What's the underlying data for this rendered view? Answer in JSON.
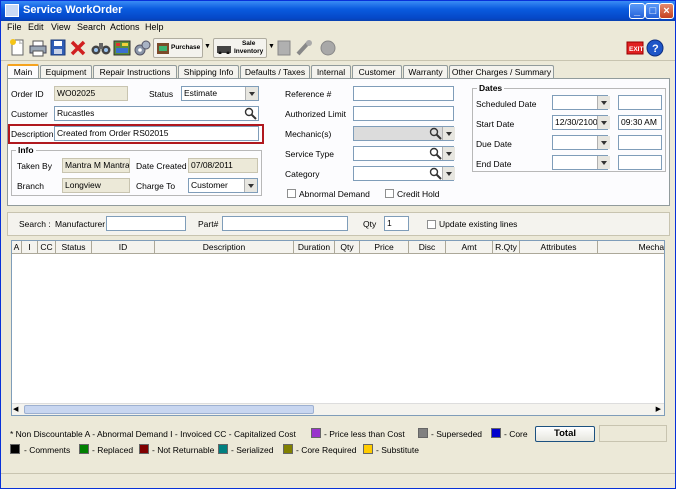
{
  "window": {
    "title": "Service WorkOrder"
  },
  "menu": [
    "File",
    "Edit",
    "View",
    "Search",
    "Actions",
    "Help"
  ],
  "toolbar": {
    "purchase_label": "Purchase",
    "sale_label_1": "Sale",
    "sale_label_2": "Inventory"
  },
  "tabs": [
    "Main",
    "Equipment",
    "Repair Instructions",
    "Shipping Info",
    "Defaults / Taxes",
    "Internal",
    "Customer",
    "Warranty",
    "Other Charges / Summary"
  ],
  "main": {
    "order_id_label": "Order ID",
    "order_id": "WO02025",
    "status_label": "Status",
    "status": "Estimate",
    "customer_label": "Customer",
    "customer": "Rucastles",
    "description_label": "Description",
    "description": "Created from Order RS02015",
    "info_title": "Info",
    "taken_by_label": "Taken By",
    "taken_by": "Mantra M Mantra",
    "date_created_label": "Date Created",
    "date_created": "07/08/2011",
    "branch_label": "Branch",
    "branch": "Longview",
    "charge_to_label": "Charge To",
    "charge_to": "Customer",
    "reference_label": "Reference #",
    "authorized_limit_label": "Authorized Limit",
    "mechanics_label": "Mechanic(s)",
    "service_type_label": "Service Type",
    "category_label": "Category",
    "abnormal_demand_label": "Abnormal Demand",
    "credit_hold_label": "Credit Hold",
    "dates_title": "Dates",
    "scheduled_date_label": "Scheduled Date",
    "start_date_label": "Start Date",
    "start_date": "12/30/2100",
    "start_time": "09:30 AM",
    "due_date_label": "Due Date",
    "end_date_label": "End Date"
  },
  "search": {
    "search_label": "Search :",
    "manufacturer_label": "Manufacturer",
    "part_label": "Part#",
    "qty_label": "Qty",
    "qty": "1",
    "update_existing_label": "Update existing lines"
  },
  "grid": {
    "columns": [
      "A",
      "I",
      "CC",
      "Status",
      "ID",
      "Description",
      "Duration",
      "Qty",
      "Price",
      "Disc",
      "Amt",
      "R.Qty",
      "Attributes",
      "Mechanic"
    ]
  },
  "legend": {
    "row1_text": "* Non Discountable   A - Abnormal Demand   I - Invoiced   CC - Capitalized Cost",
    "price_less": "- Price less than Cost",
    "superseded": "- Superseded",
    "core": "- Core",
    "total_label": "Total",
    "comments": "- Comments",
    "replaced": "- Replaced",
    "not_returnable": "- Not Returnable",
    "serialized": "- Serialized",
    "core_required": "- Core Required",
    "substitute": "- Substitute",
    "colors": {
      "price_less": "#9933CC",
      "superseded": "#808080",
      "core": "#0000CC",
      "comments": "#000000",
      "replaced": "#008000",
      "not_returnable": "#800000",
      "serialized": "#008080",
      "core_required": "#808000",
      "substitute": "#FFCC00"
    }
  }
}
